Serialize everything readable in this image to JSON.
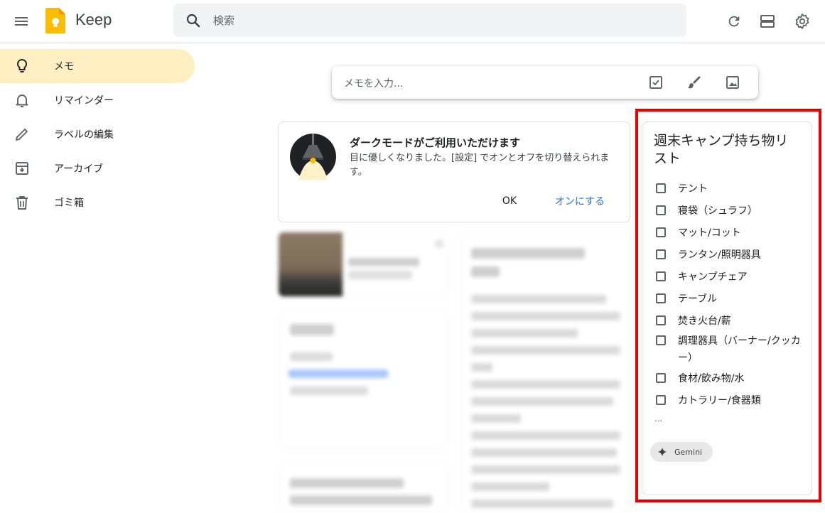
{
  "app": {
    "title": "Keep"
  },
  "search": {
    "placeholder": "検索"
  },
  "sidebar": {
    "items": [
      {
        "label": "メモ",
        "icon": "lightbulb-icon",
        "active": true
      },
      {
        "label": "リマインダー",
        "icon": "bell-icon",
        "active": false
      },
      {
        "label": "ラベルの編集",
        "icon": "pencil-icon",
        "active": false
      },
      {
        "label": "アーカイブ",
        "icon": "archive-icon",
        "active": false
      },
      {
        "label": "ゴミ箱",
        "icon": "trash-icon",
        "active": false
      }
    ]
  },
  "note_input": {
    "placeholder": "メモを入力..."
  },
  "dark_mode_card": {
    "title": "ダークモードがご利用いただけます",
    "body": "目に優しくなりました。[設定] でオンとオフを切り替えられます。",
    "ok_label": "OK",
    "enable_label": "オンにする"
  },
  "checklist_card": {
    "title": "週末キャンプ持ち物リスト",
    "items": [
      "テント",
      "寝袋（シュラフ）",
      "マット/コット",
      "ランタン/照明器具",
      "キャンプチェア",
      "テーブル",
      "焚き火台/薪",
      "調理器具（バーナー/クッカー）",
      "食材/飲み物/水",
      "カトラリー/食器類"
    ],
    "more": "...",
    "gemini_label": "Gemini"
  },
  "colors": {
    "active_nav": "#feefc3",
    "highlight_border": "#e60000",
    "link_blue": "#1a73e8",
    "logo_yellow": "#fbbc04"
  }
}
